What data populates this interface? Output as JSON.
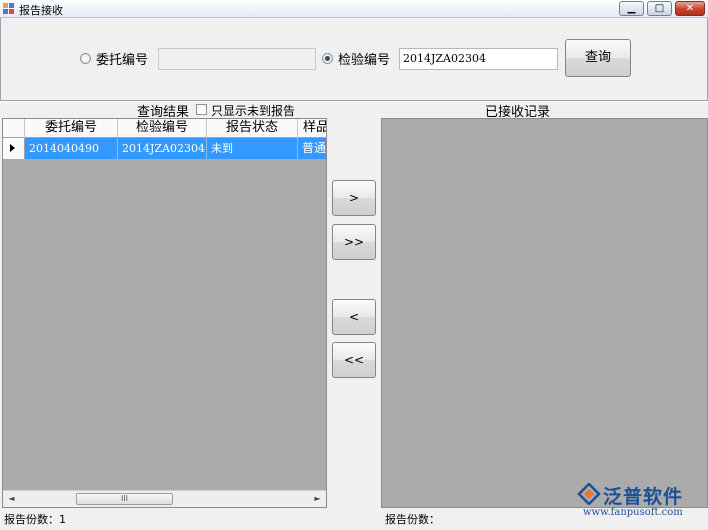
{
  "window": {
    "title": "报告接收",
    "minimize_glyph": "▁",
    "maximize_glyph": "□",
    "close_glyph": "✕"
  },
  "search": {
    "consign_label": "委托编号",
    "consign_value": "",
    "inspect_label": "检验编号",
    "inspect_value": "2014JZA02304",
    "query_button": "查询",
    "selected": "inspect"
  },
  "results": {
    "title": "查询结果",
    "filter_label": "只显示未到报告",
    "columns": [
      "委托编号",
      "检验编号",
      "报告状态",
      "样品"
    ],
    "rows": [
      [
        "2014040490",
        "2014JZA02304",
        "未到",
        "普通"
      ]
    ],
    "count_label": "报告份数：1",
    "scroll_left": "◄",
    "scroll_right": "►",
    "scroll_grip": "III"
  },
  "transfer": {
    "move_one": ">",
    "move_all": ">>",
    "back_one": "<",
    "back_all": "<<"
  },
  "received": {
    "title": "已接收记录",
    "count_label": "报告份数："
  },
  "watermark": {
    "name": "泛普软件",
    "url": "www.fanpusoft.com"
  },
  "colors": {
    "selection": "#3399ff",
    "grid_bg": "#ababab",
    "brand": "#1d4f96"
  }
}
